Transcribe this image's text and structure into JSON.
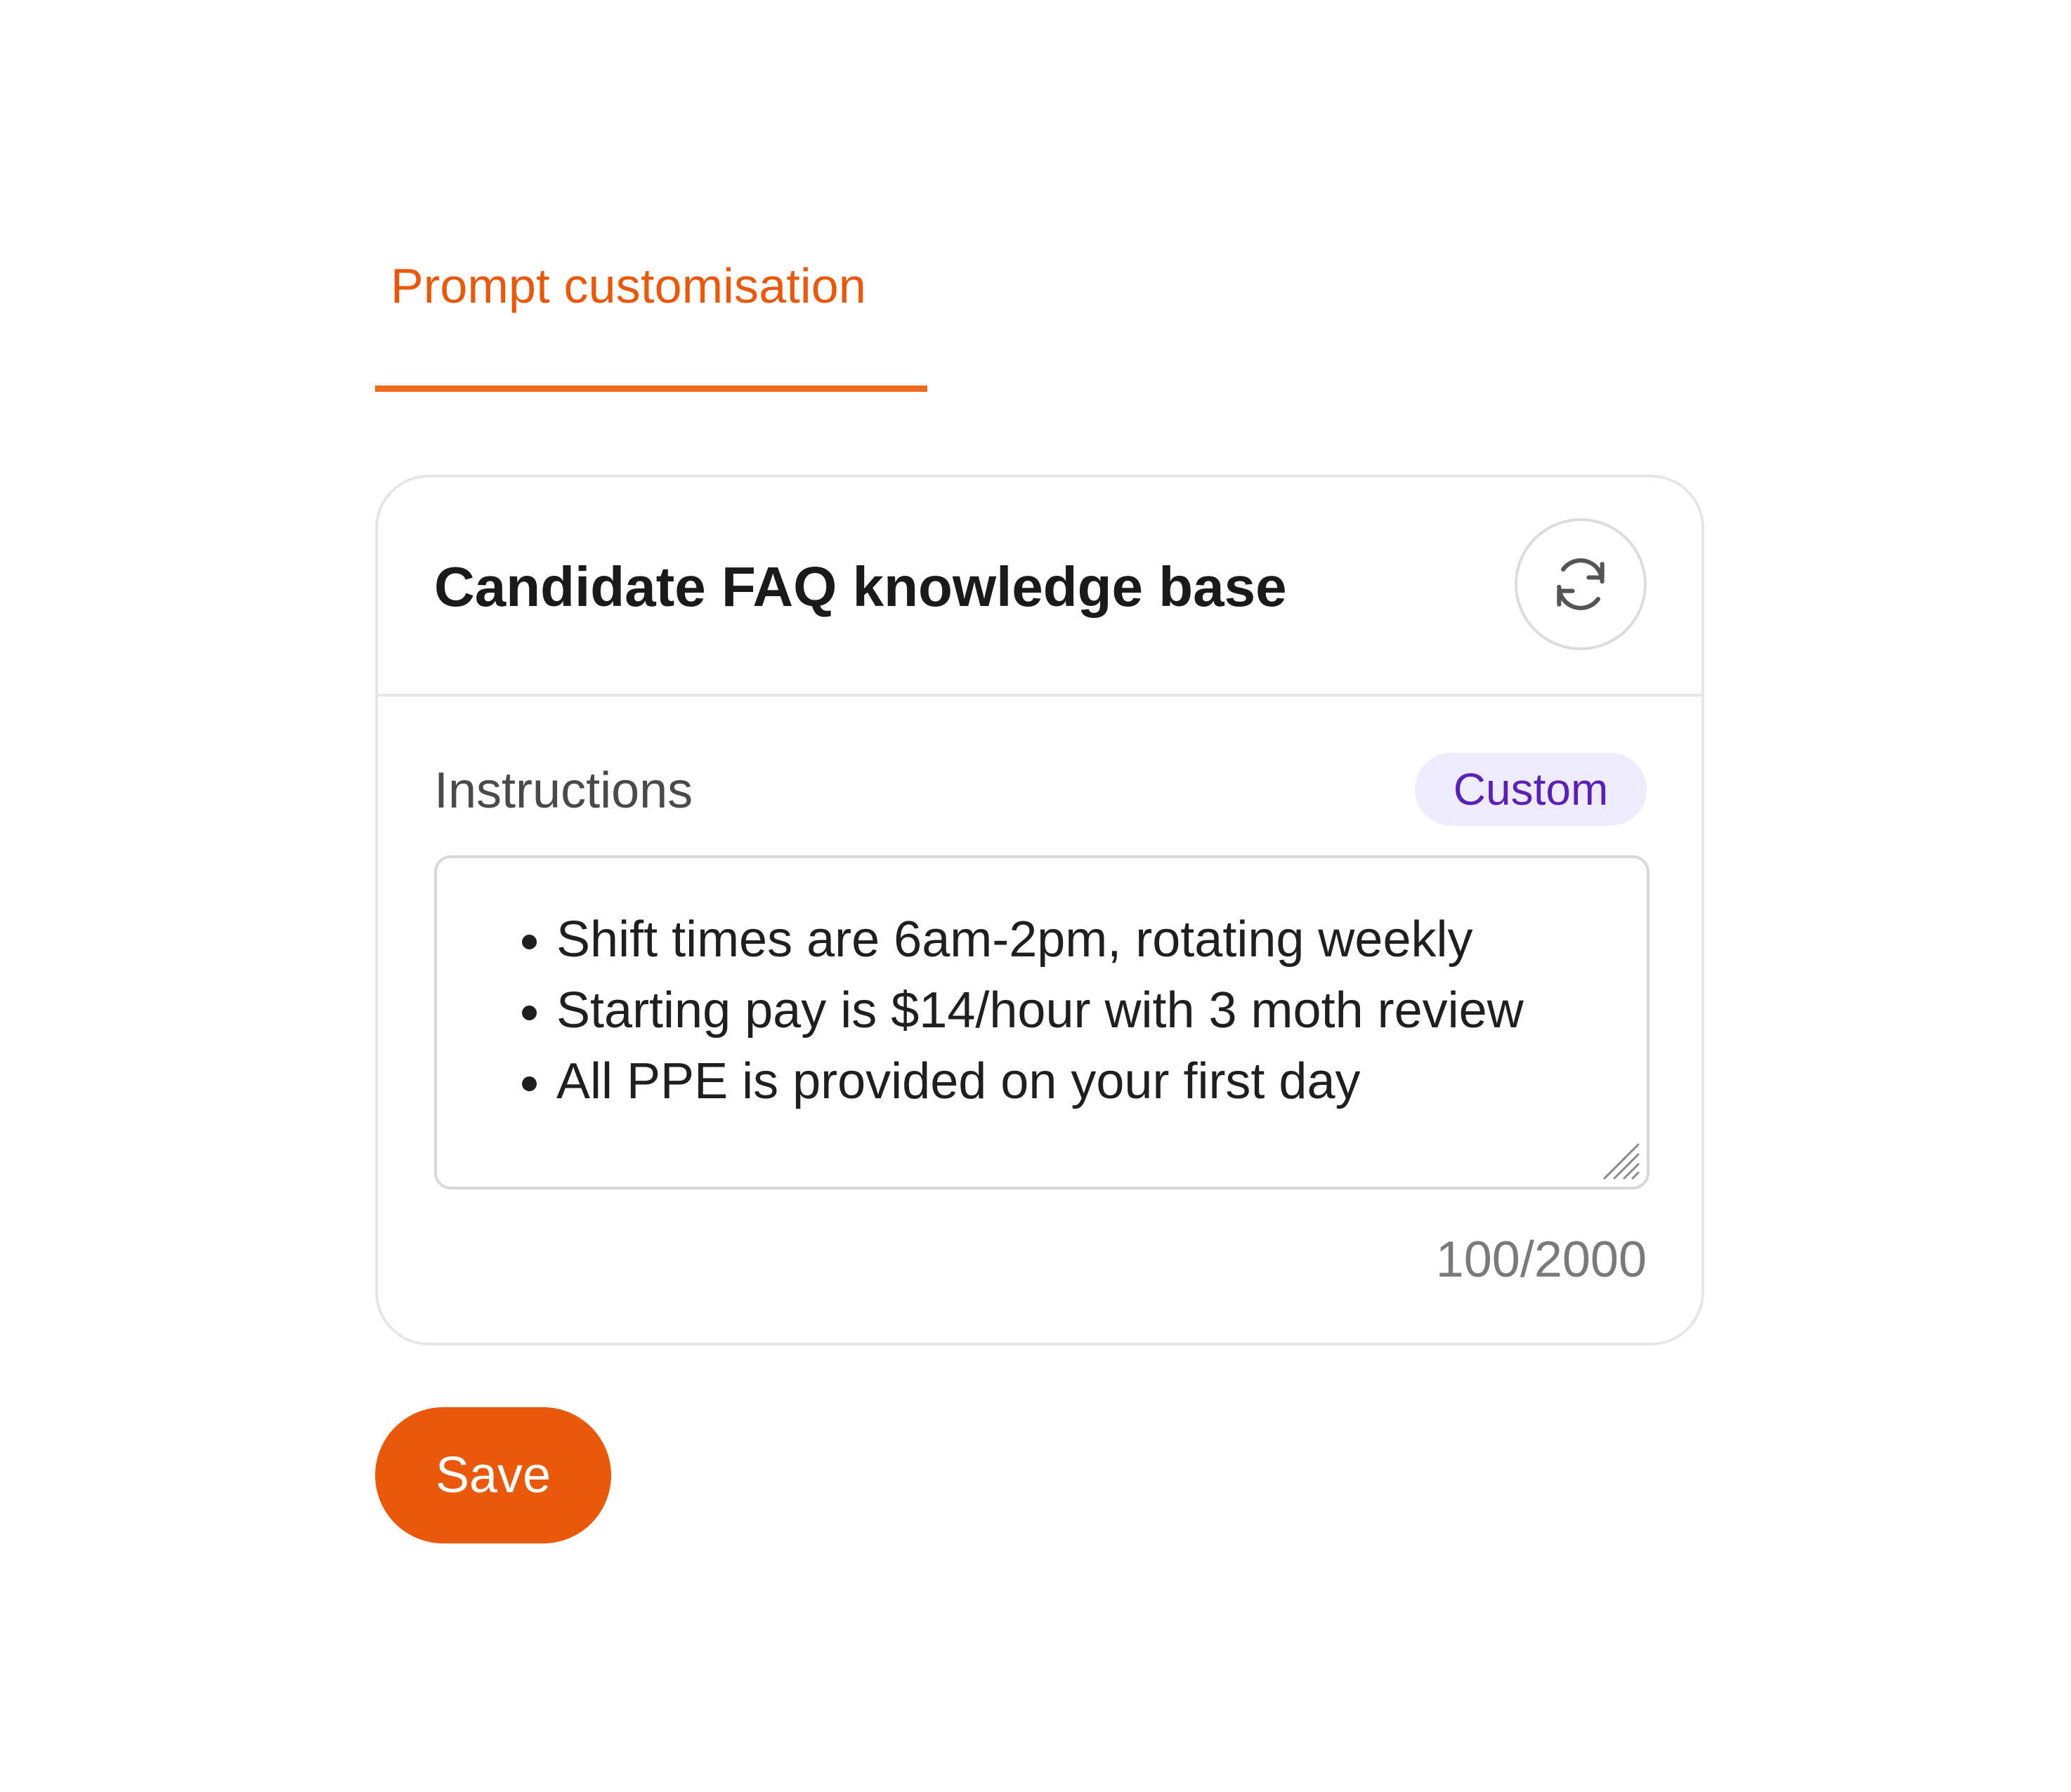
{
  "tabs": {
    "active_label": "Prompt customisation"
  },
  "card": {
    "title": "Candidate FAQ knowledge base",
    "refresh_icon": "refresh-icon",
    "instructions": {
      "label": "Instructions",
      "badge": "Custom",
      "items": [
        "Shift times are 6am-2pm, rotating weekly",
        "Starting pay is $14/hour with 3 moth review",
        "All PPE is provided on your first day"
      ],
      "resize_icon": "resize-handle-icon",
      "char_count": "100/2000"
    }
  },
  "actions": {
    "save_label": "Save"
  },
  "colors": {
    "accent": "#E8590C",
    "tab_underline": "#ED6A1F",
    "badge_bg": "#EEEBFC",
    "badge_text": "#5B21B6",
    "border": "#E6E6E6"
  }
}
